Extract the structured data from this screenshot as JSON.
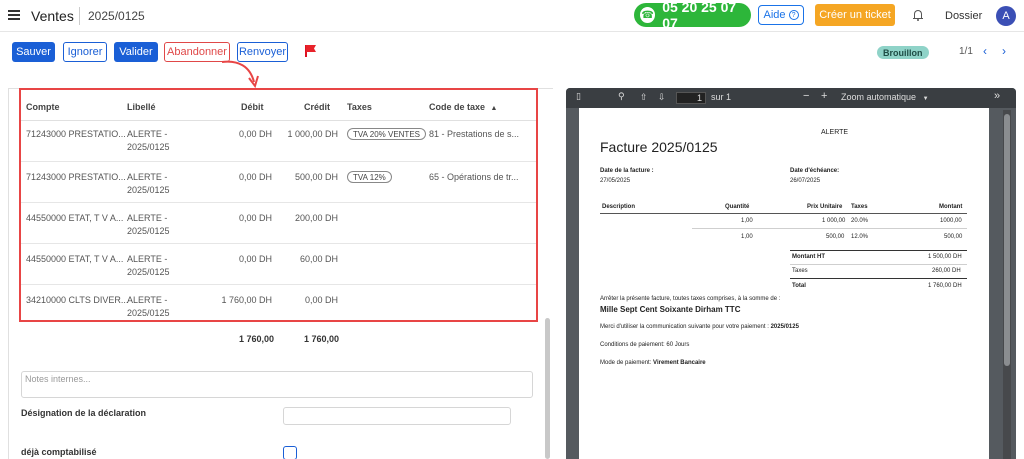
{
  "topbar": {
    "app_title": "Ventes",
    "record_ref": "2025/0125",
    "phone": "05 20 25 07 07",
    "help_label": "Aide",
    "ticket_label": "Créer un ticket",
    "dossier_label": "Dossier",
    "avatar_initial": "A"
  },
  "actions": {
    "save": "Sauver",
    "ignore": "Ignorer",
    "validate": "Valider",
    "abandon": "Abandonner",
    "resend": "Renvoyer",
    "status": "Brouillon",
    "pager": "1/1"
  },
  "table": {
    "headers": [
      "Compte",
      "Libellé",
      "Débit",
      "Crédit",
      "Taxes",
      "Code de taxe"
    ],
    "rows": [
      {
        "compte": "71243000 PRESTATIO...",
        "libelle_1": "ALERTE -",
        "libelle_2": "2025/0125",
        "debit": "0,00 DH",
        "credit": "1 000,00 DH",
        "taxe": "TVA 20% VENTES",
        "code": "81 - Prestations de s..."
      },
      {
        "compte": "71243000 PRESTATIO...",
        "libelle_1": "ALERTE -",
        "libelle_2": "2025/0125",
        "debit": "0,00 DH",
        "credit": "500,00 DH",
        "taxe": "TVA 12%",
        "code": "65 - Opérations de tr..."
      },
      {
        "compte": "44550000 ETAT, T V A...",
        "libelle_1": "ALERTE -",
        "libelle_2": "2025/0125",
        "debit": "0,00 DH",
        "credit": "200,00 DH",
        "taxe": "",
        "code": ""
      },
      {
        "compte": "44550000 ETAT, T V A...",
        "libelle_1": "ALERTE -",
        "libelle_2": "2025/0125",
        "debit": "0,00 DH",
        "credit": "60,00 DH",
        "taxe": "",
        "code": ""
      },
      {
        "compte": "34210000 CLTS DIVER...",
        "libelle_1": "ALERTE -",
        "libelle_2": "2025/0125",
        "debit": "1 760,00 DH",
        "credit": "0,00 DH",
        "taxe": "",
        "code": ""
      }
    ],
    "total_debit": "1 760,00",
    "total_credit": "1 760,00"
  },
  "form": {
    "notes_placeholder": "Notes internes...",
    "declaration_label": "Désignation de la déclaration",
    "accounted_label": "déjà comptabilisé"
  },
  "viewer": {
    "page_input": "1",
    "page_total": "sur 1",
    "zoom": "Zoom automatique"
  },
  "invoice": {
    "client": "ALERTE",
    "title": "Facture 2025/0125",
    "date_label": "Date de la facture :",
    "date_value": "27/05/2025",
    "due_label": "Date d'échéance:",
    "due_value": "26/07/2025",
    "col_desc": "Description",
    "col_qty": "Quantité",
    "col_unit": "Prix Unitaire",
    "col_tax": "Taxes",
    "col_amount": "Montant",
    "lines": [
      {
        "qty": "1,00",
        "unit": "1 000,00",
        "tax": "20.0%",
        "amount": "1000,00"
      },
      {
        "qty": "1,00",
        "unit": "500,00",
        "tax": "12.0%",
        "amount": "500,00"
      }
    ],
    "ht_label": "Montant HT",
    "ht_value": "1 500,00 DH",
    "taxes_label": "Taxes",
    "taxes_value": "260,00 DH",
    "total_label": "Total",
    "total_value": "1 760,00 DH",
    "stop_text": "Arrêter la présente facture, toutes taxes comprises, à la somme de :",
    "amount_words": "Mille Sept Cent Soixante Dirham TTC",
    "comm_text": "Merci d'utiliser la communication suivante pour votre paiement :",
    "comm_ref": "2025/0125",
    "conditions": "Conditions de paiement: 60 Jours",
    "mode_label": "Mode de paiement:",
    "mode_value": "Virement Bancaire"
  }
}
